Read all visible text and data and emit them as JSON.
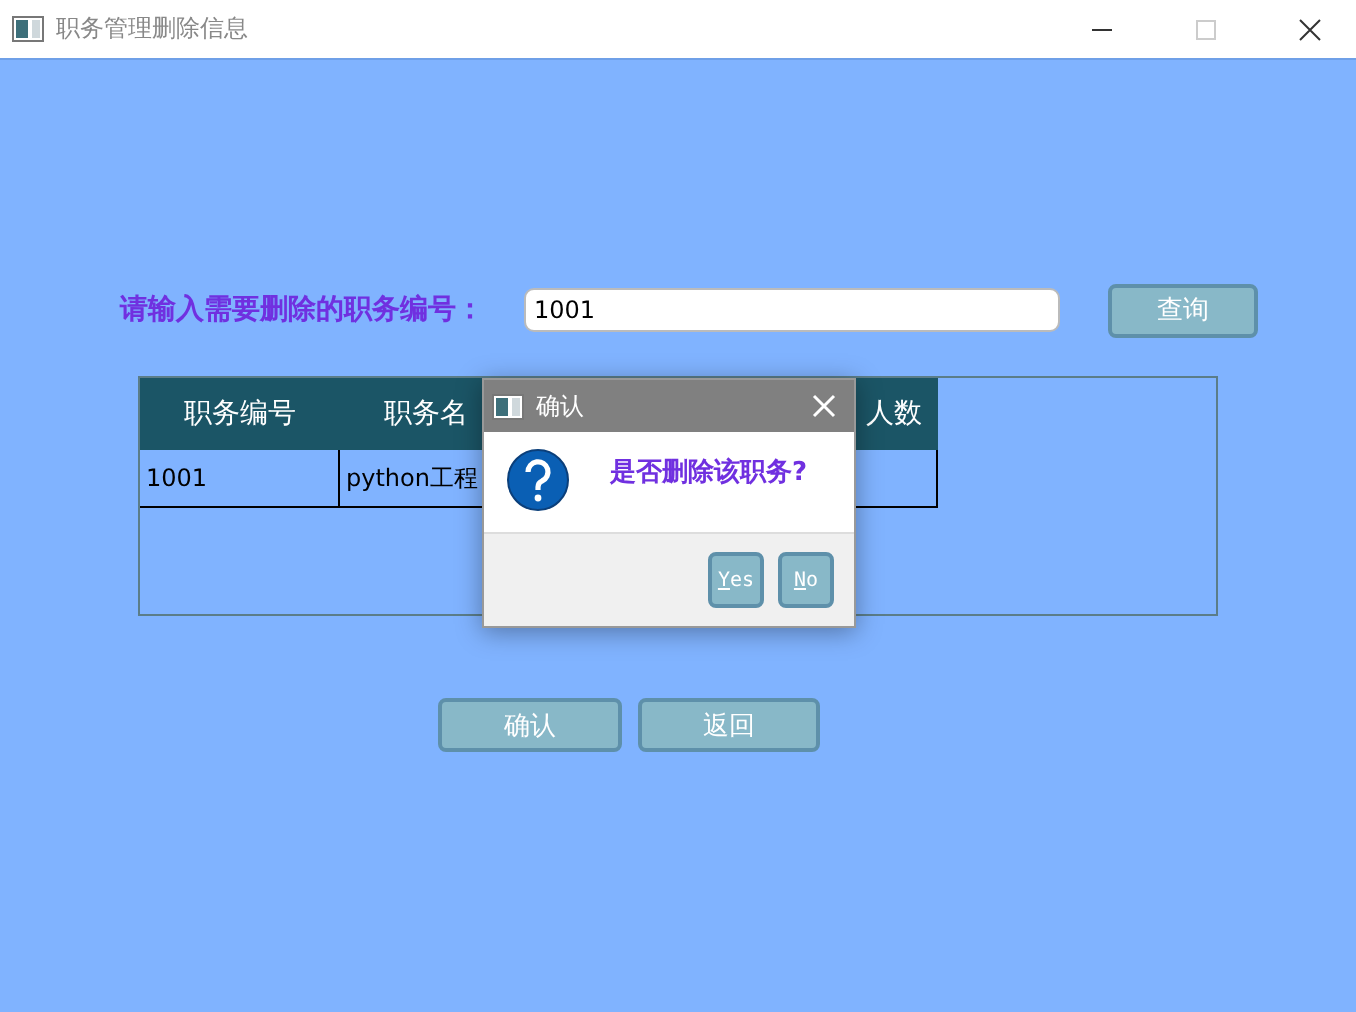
{
  "window": {
    "title": "职务管理删除信息"
  },
  "search": {
    "label": "请输入需要删除的职务编号：",
    "value": "1001",
    "button": "查询"
  },
  "table": {
    "columns": [
      "职务编号",
      "职务名",
      "人数"
    ],
    "rows": [
      [
        "1001",
        "python工程"
      ]
    ]
  },
  "buttons": [
    "确认",
    "返回"
  ],
  "dialog": {
    "title": "确认",
    "message": "是否删除该职务?",
    "buttons": [
      "Yes",
      "No"
    ]
  }
}
